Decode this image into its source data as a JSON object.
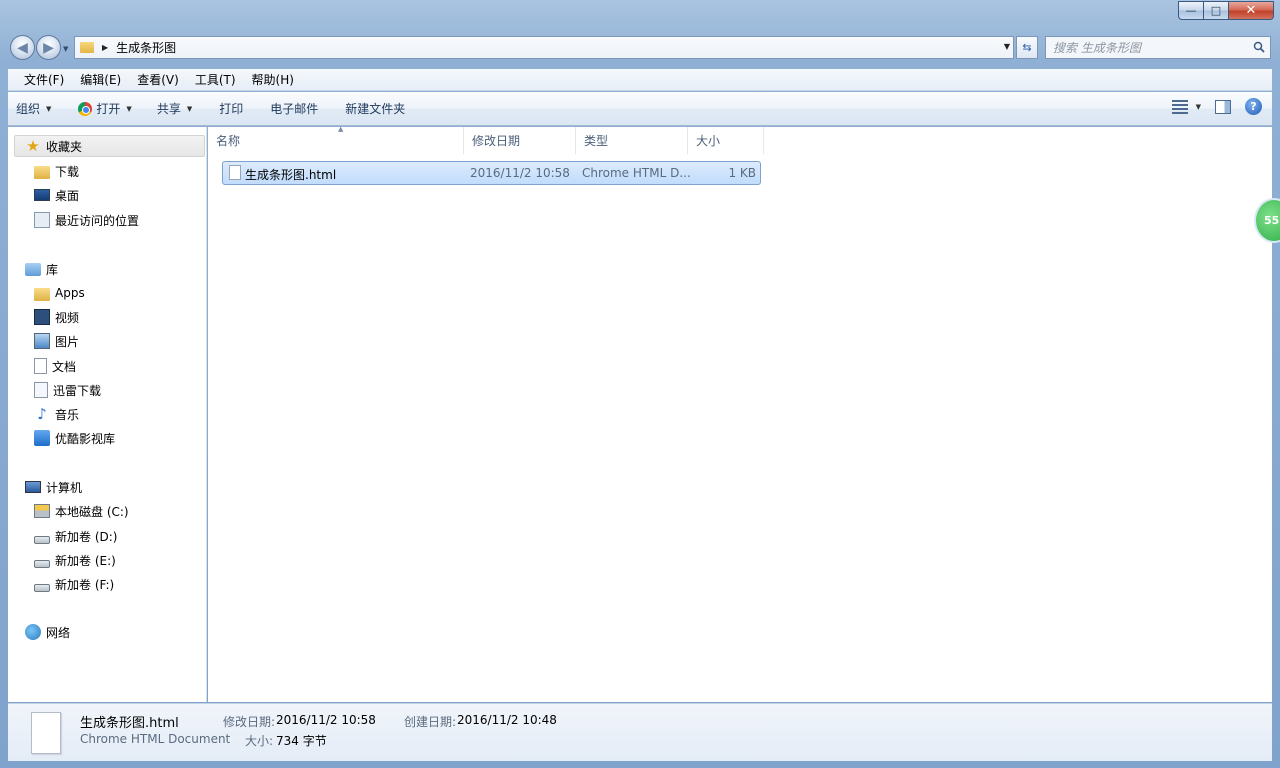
{
  "window": {
    "caption": {
      "minimize": "—",
      "maximize": "□",
      "close": "✕"
    }
  },
  "nav": {
    "address_path": "生成条形图",
    "search_placeholder": "搜索 生成条形图"
  },
  "menubar": [
    "文件(F)",
    "编辑(E)",
    "查看(V)",
    "工具(T)",
    "帮助(H)"
  ],
  "commandbar": {
    "organize": "组织",
    "open": "打开",
    "share": "共享",
    "print": "打印",
    "email": "电子邮件",
    "new_folder": "新建文件夹"
  },
  "sidebar": {
    "favorites": {
      "label": "收藏夹",
      "items": [
        "下载",
        "桌面",
        "最近访问的位置"
      ]
    },
    "libraries": {
      "label": "库",
      "items": [
        "Apps",
        "视频",
        "图片",
        "文档",
        "迅雷下载",
        "音乐",
        "优酷影视库"
      ]
    },
    "computer": {
      "label": "计算机",
      "items": [
        "本地磁盘 (C:)",
        "新加卷 (D:)",
        "新加卷 (E:)",
        "新加卷 (F:)"
      ]
    },
    "network": {
      "label": "网络"
    }
  },
  "columns": [
    "名称",
    "修改日期",
    "类型",
    "大小"
  ],
  "files": [
    {
      "name": "生成条形图.html",
      "modified": "2016/11/2 10:58",
      "type": "Chrome HTML D...",
      "size": "1 KB"
    }
  ],
  "details": {
    "filename": "生成条形图.html",
    "filetype": "Chrome HTML Document",
    "modified_label": "修改日期:",
    "modified_value": "2016/11/2 10:58",
    "created_label": "创建日期:",
    "created_value": "2016/11/2 10:48",
    "size_label": "大小:",
    "size_value": "734 字节"
  },
  "edge_badge": "55"
}
